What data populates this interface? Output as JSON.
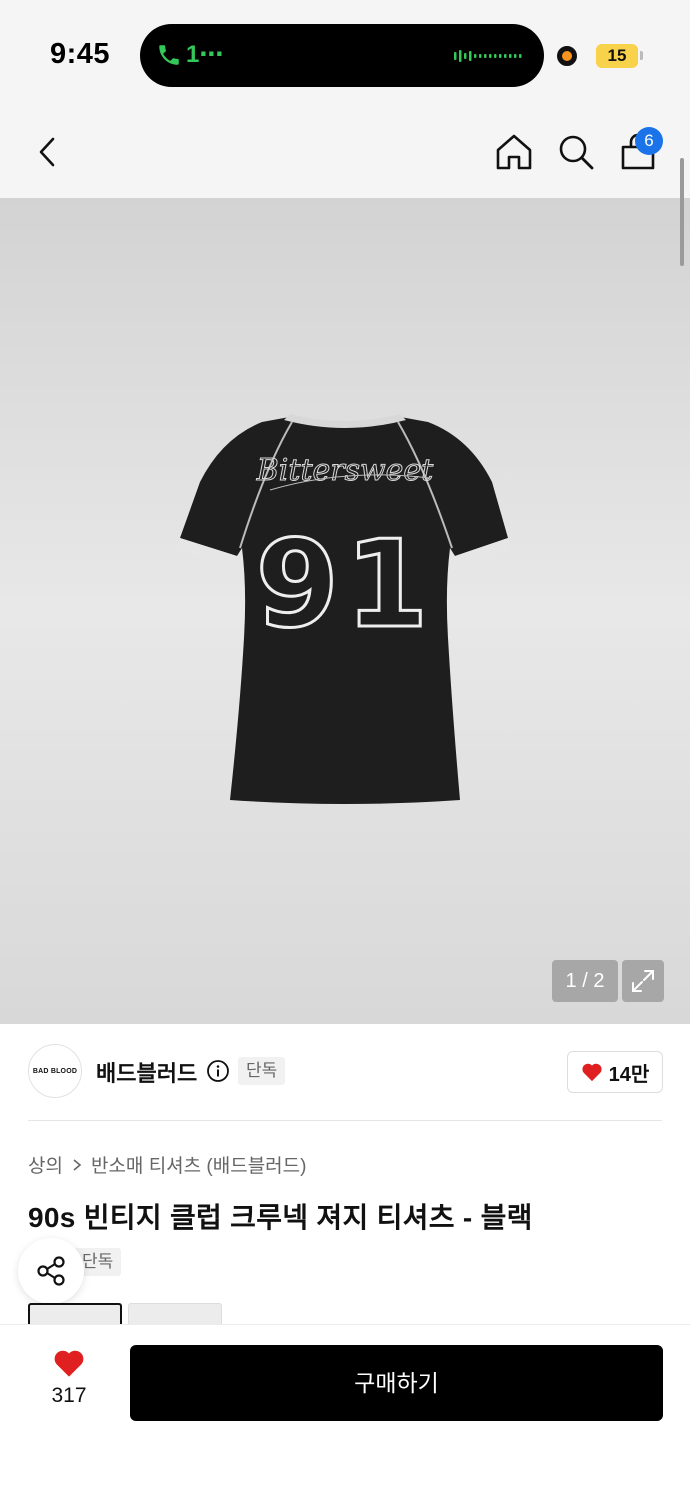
{
  "status_bar": {
    "time": "9:45",
    "call_indicator": "1⋯",
    "battery_level": "15"
  },
  "nav": {
    "back_icon": "chevron-left-icon",
    "home_icon": "home-icon",
    "search_icon": "search-icon",
    "cart_icon": "shopping-bag-icon",
    "cart_count": "6"
  },
  "gallery": {
    "page_indicator": "1 / 2",
    "expand_icon": "expand-icon",
    "shirt_print_script": "Bittersweet",
    "shirt_print_number": "91"
  },
  "brand": {
    "logo_text": "BAD BLOOD",
    "name": "배드블러드",
    "badge": "단독",
    "like_count": "14만"
  },
  "product": {
    "breadcrumb": [
      "상의",
      "반소매 티셔츠 (배드블러드)"
    ],
    "title": "90s 빈티지 클럽 크루넥 져지 티셔츠 - 블랙",
    "tag": "단독"
  },
  "bottom_bar": {
    "like_count": "317",
    "buy_label": "구매하기"
  },
  "colors": {
    "accent_badge": "#1a73e8",
    "heart": "#e02020",
    "buy_button": "#000000",
    "call_green": "#34c759"
  }
}
